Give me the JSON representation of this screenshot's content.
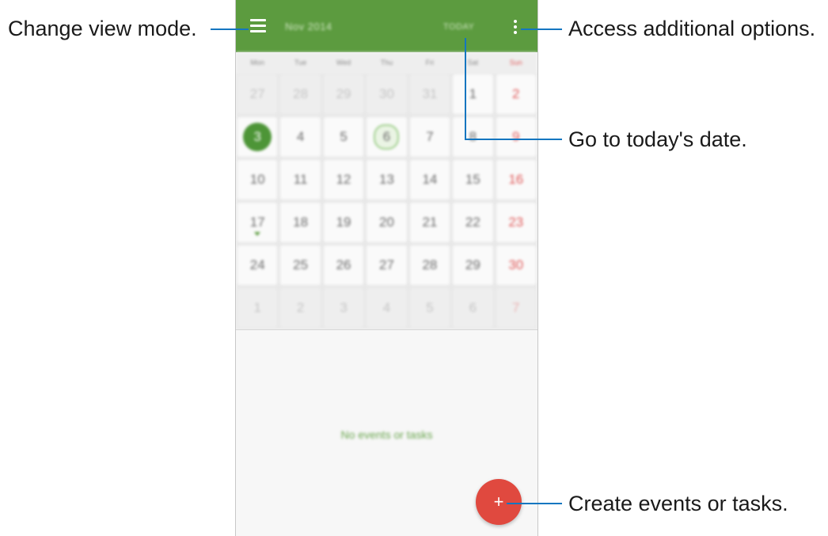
{
  "callouts": {
    "view_mode": "Change view mode.",
    "more_options": "Access additional options.",
    "today": "Go to today's date.",
    "create": "Create events or tasks."
  },
  "app": {
    "month_title": "Nov 2014",
    "today_label": "TODAY",
    "menu_icon": "hamburger-menu-icon",
    "more_icon": "vertical-dots-icon",
    "fab_label": "+",
    "fab_icon": "plus-icon",
    "empty_message": "No events or tasks",
    "accent_color": "#5c9b3f",
    "fab_color": "#e0493f"
  },
  "weekdays": [
    "Mon",
    "Tue",
    "Wed",
    "Thu",
    "Fri",
    "Sat",
    "Sun"
  ],
  "weeks": [
    [
      "27",
      "28",
      "29",
      "30",
      "31",
      "1",
      "2"
    ],
    [
      "3",
      "4",
      "5",
      "6",
      "7",
      "8",
      "9"
    ],
    [
      "10",
      "11",
      "12",
      "13",
      "14",
      "15",
      "16"
    ],
    [
      "17",
      "18",
      "19",
      "20",
      "21",
      "22",
      "23"
    ],
    [
      "24",
      "25",
      "26",
      "27",
      "28",
      "29",
      "30"
    ],
    [
      "1",
      "2",
      "3",
      "4",
      "5",
      "6",
      "7"
    ]
  ],
  "selected_date": "3",
  "today_date": "6",
  "event_date": "17"
}
